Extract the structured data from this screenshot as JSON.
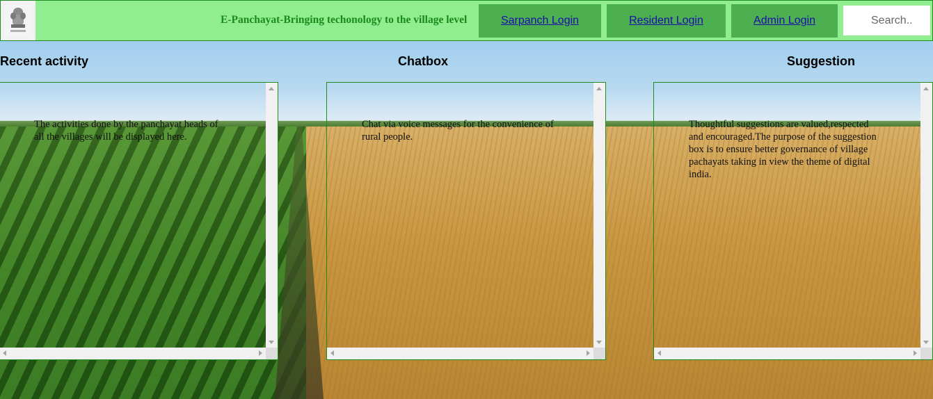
{
  "header": {
    "logo_icon": "national-emblem-icon",
    "tagline": "E-Panchayat-Bringing techonology to the village level",
    "nav": {
      "sarpanch_login": "Sarpanch Login",
      "resident_login": "Resident Login",
      "admin_login": "Admin Login"
    },
    "search": {
      "placeholder": "Search..",
      "value": ""
    }
  },
  "sections": {
    "recent_activity": {
      "title": "Recent activity",
      "text": "The activities done by the panchayat heads of all the villages will be displayed here."
    },
    "chatbox": {
      "title": "Chatbox",
      "text": "Chat via voice messages for the convenience of rural people."
    },
    "suggestion": {
      "title": "Suggestion",
      "text": "Thoughtful suggestions are valued,respected and encouraged.The purpose of the suggestion box is to ensure better governance of village pachayats taking in view the theme of digital india."
    }
  },
  "colors": {
    "header_bg": "#90ee90",
    "button_bg": "#4caf50",
    "tagline": "#1a8a1a",
    "link": "#1a0dab",
    "border": "#1f8b1f"
  }
}
